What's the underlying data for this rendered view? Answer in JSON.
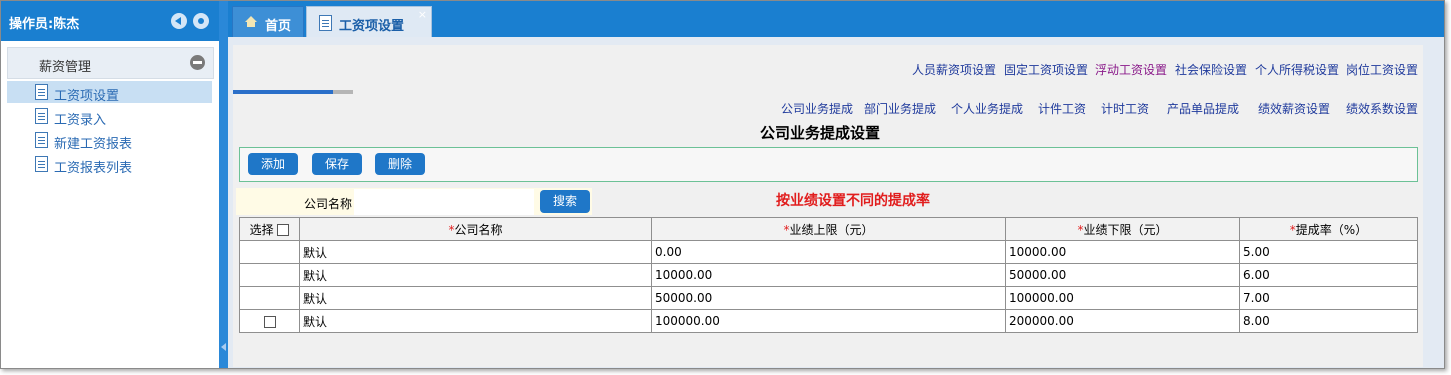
{
  "sidebar": {
    "operator_label": "操作员:陈杰",
    "section_title": "薪资管理",
    "items": [
      {
        "label": "工资项设置"
      },
      {
        "label": "工资录入"
      },
      {
        "label": "新建工资报表"
      },
      {
        "label": "工资报表列表"
      }
    ]
  },
  "tabs": [
    {
      "label": "首页"
    },
    {
      "label": "工资项设置",
      "close": "×"
    }
  ],
  "top_links": [
    "人员薪资项设置",
    "固定工资项设置",
    "浮动工资设置",
    "社会保险设置",
    "个人所得税设置",
    "岗位工资设置"
  ],
  "sub_links": [
    "公司业务提成",
    "部门业务提成",
    "个人业务提成",
    "计件工资",
    "计时工资",
    "产品单品提成",
    "绩效薪资设置",
    "绩效系数设置"
  ],
  "progress": {
    "fraction": 0.83
  },
  "page_title": "公司业务提成设置",
  "toolbar": {
    "add": "添加",
    "save": "保存",
    "delete": "删除"
  },
  "search": {
    "label": "公司名称",
    "value": "",
    "button": "搜索"
  },
  "hint": "按业绩设置不同的提成率",
  "table": {
    "select_header": "选择",
    "required_mark": "*",
    "headers": [
      "公司名称",
      "业绩上限（元）",
      "业绩下限（元）",
      "提成率（%）"
    ],
    "rows": [
      {
        "company": "默认",
        "upper": "0.00",
        "lower": "10000.00",
        "rate": "5.00"
      },
      {
        "company": "默认",
        "upper": "10000.00",
        "lower": "50000.00",
        "rate": "6.00"
      },
      {
        "company": "默认",
        "upper": "50000.00",
        "lower": "100000.00",
        "rate": "7.00"
      },
      {
        "company": "默认",
        "upper": "100000.00",
        "lower": "200000.00",
        "rate": "8.00"
      }
    ]
  },
  "colors": {
    "brand": "#1a7fd0",
    "button": "#1f77c8",
    "hint": "#e11d1d",
    "link": "#1f3a9c",
    "link_selected": "#8a1a8a"
  }
}
